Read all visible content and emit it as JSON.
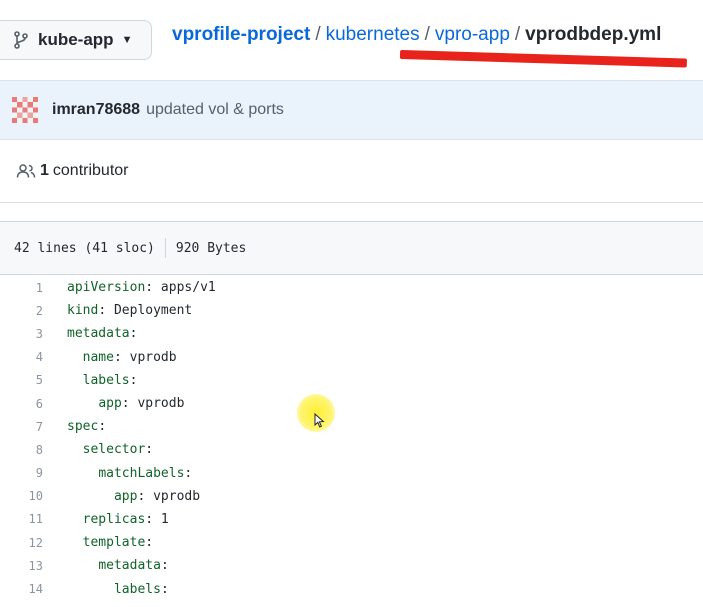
{
  "branch": {
    "name": "kube-app",
    "icon": "git-branch-icon"
  },
  "breadcrumb": {
    "repo": "vprofile-project",
    "sep1": "/",
    "folder1": "kubernetes",
    "sep2": "/",
    "folder2": "vpro-app",
    "sep3": "/",
    "file": "vprodbdep.yml"
  },
  "annotation": {
    "underline_color": "#e8231c"
  },
  "commit": {
    "author": "imran78688",
    "message": "updated vol & ports",
    "avatar_icon": "identicon-avatar"
  },
  "contributors": {
    "count": "1",
    "label": "contributor",
    "icon": "people-icon"
  },
  "file_info": {
    "lines": "42 lines (41 sloc)",
    "size": "920 Bytes"
  },
  "code_lines": [
    {
      "num": "1",
      "key": "apiVersion",
      "rest": ": apps/v1",
      "indent": ""
    },
    {
      "num": "2",
      "key": "kind",
      "rest": ": Deployment",
      "indent": ""
    },
    {
      "num": "3",
      "key": "metadata",
      "rest": ":",
      "indent": ""
    },
    {
      "num": "4",
      "key": "name",
      "rest": ": vprodb",
      "indent": "  "
    },
    {
      "num": "5",
      "key": "labels",
      "rest": ":",
      "indent": "  "
    },
    {
      "num": "6",
      "key": "app",
      "rest": ": vprodb",
      "indent": "    "
    },
    {
      "num": "7",
      "key": "spec",
      "rest": ":",
      "indent": ""
    },
    {
      "num": "8",
      "key": "selector",
      "rest": ":",
      "indent": "  "
    },
    {
      "num": "9",
      "key": "matchLabels",
      "rest": ":",
      "indent": "    "
    },
    {
      "num": "10",
      "key": "app",
      "rest": ": vprodb",
      "indent": "      "
    },
    {
      "num": "11",
      "key": "replicas",
      "rest": ": 1",
      "indent": "  "
    },
    {
      "num": "12",
      "key": "template",
      "rest": ":",
      "indent": "  "
    },
    {
      "num": "13",
      "key": "metadata",
      "rest": ":",
      "indent": "    "
    },
    {
      "num": "14",
      "key": "labels",
      "rest": ":",
      "indent": "      "
    }
  ],
  "colors": {
    "link": "#0969da",
    "commit_bg": "#eaf3fc",
    "yaml_key": "#116329"
  }
}
